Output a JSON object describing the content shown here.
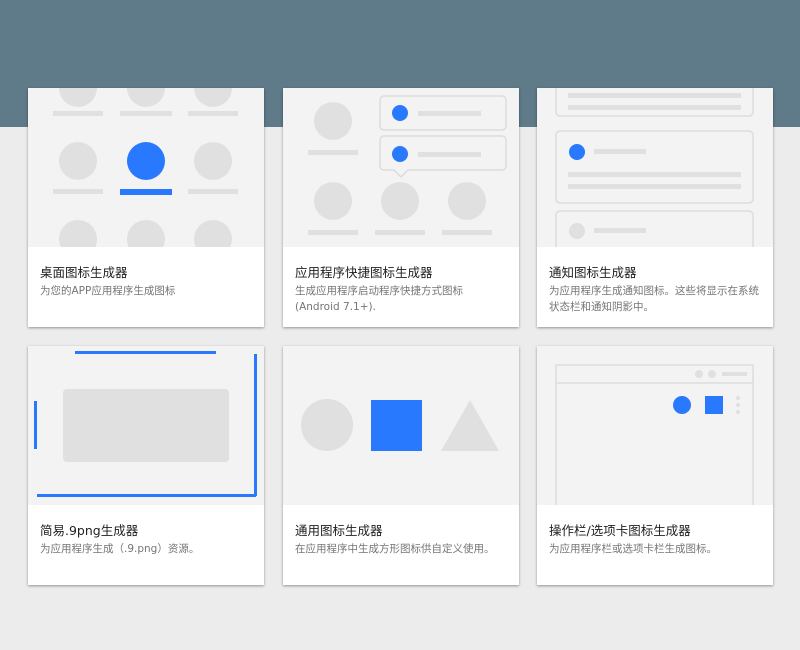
{
  "cards": [
    {
      "title": "桌面图标生成器",
      "desc": "为您的APP应用程序生成图标"
    },
    {
      "title": "应用程序快捷图标生成器",
      "desc": "生成应用程序启动程序快捷方式图标 (Android 7.1+)."
    },
    {
      "title": "通知图标生成器",
      "desc": "为应用程序生成通知图标。这些将显示在系统状态栏和通知阴影中。"
    },
    {
      "title": "简易.9png生成器",
      "desc": "为应用程序生成（.9.png）资源。"
    },
    {
      "title": "通用图标生成器",
      "desc": "在应用程序中生成方形图标供自定义使用。"
    },
    {
      "title": "操作栏/选项卡图标生成器",
      "desc": "为应用程序栏或选项卡栏生成图标。"
    }
  ],
  "colors": {
    "header": "#5f7a89",
    "accent": "#2979ff",
    "placeholder": "#e0e0e0",
    "preview_bg": "#f3f3f3"
  }
}
